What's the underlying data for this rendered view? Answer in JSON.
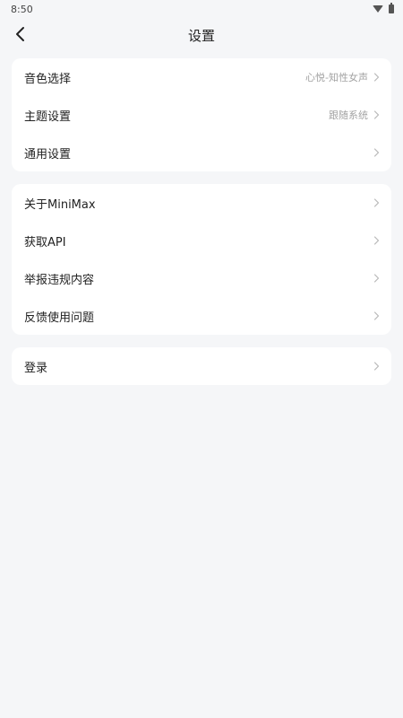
{
  "status": {
    "time": "8:50"
  },
  "header": {
    "title": "设置"
  },
  "groups": [
    {
      "items": [
        {
          "label": "音色选择",
          "value": "心悦-知性女声"
        },
        {
          "label": "主题设置",
          "value": "跟随系统"
        },
        {
          "label": "通用设置",
          "value": ""
        }
      ]
    },
    {
      "items": [
        {
          "label": "关于MiniMax"
        },
        {
          "label": "获取API"
        },
        {
          "label": "举报违规内容"
        },
        {
          "label": "反馈使用问题"
        }
      ]
    },
    {
      "items": [
        {
          "label": "登录"
        }
      ]
    }
  ]
}
